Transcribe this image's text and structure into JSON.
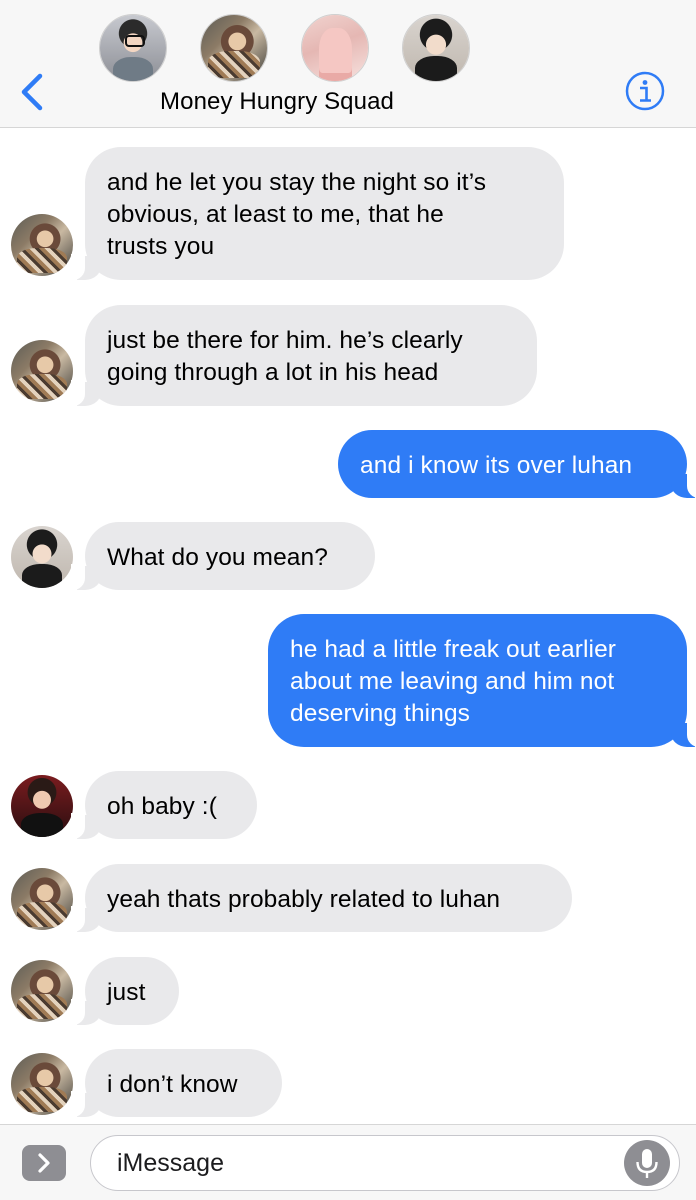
{
  "header": {
    "group_name": "Money Hungry Squad",
    "accent_color": "#2f7cf6"
  },
  "group_avatars": [
    "avatar-glasses",
    "avatar-patterned",
    "avatar-pink",
    "avatar-dark-hair"
  ],
  "messages": [
    {
      "direction": "incoming",
      "avatar": "avatar-patterned",
      "text": "and he let you stay the night so it’s\nobvious, at least to me, that he\ntrusts you"
    },
    {
      "direction": "incoming",
      "avatar": "avatar-patterned",
      "text": "just be there for him. he’s clearly\ngoing through a lot in his head"
    },
    {
      "direction": "outgoing",
      "text": "and i know its over luhan"
    },
    {
      "direction": "incoming",
      "avatar": "avatar-dark-hair",
      "text": "What do you mean?"
    },
    {
      "direction": "outgoing",
      "text": "he had a little freak out earlier\nabout me leaving and him not\ndeserving things"
    },
    {
      "direction": "incoming",
      "avatar": "avatar-red",
      "text": "oh baby :("
    },
    {
      "direction": "incoming",
      "avatar": "avatar-patterned",
      "text": "yeah thats probably related to luhan"
    },
    {
      "direction": "incoming",
      "avatar": "avatar-patterned",
      "text": "just"
    },
    {
      "direction": "incoming",
      "avatar": "avatar-patterned",
      "text": "i don’t know"
    }
  ],
  "input": {
    "placeholder": "iMessage"
  },
  "colors": {
    "incoming_bubble": "#e9e9eb",
    "outgoing_bubble": "#2f7cf6",
    "header_bg": "#f7f7f7"
  }
}
